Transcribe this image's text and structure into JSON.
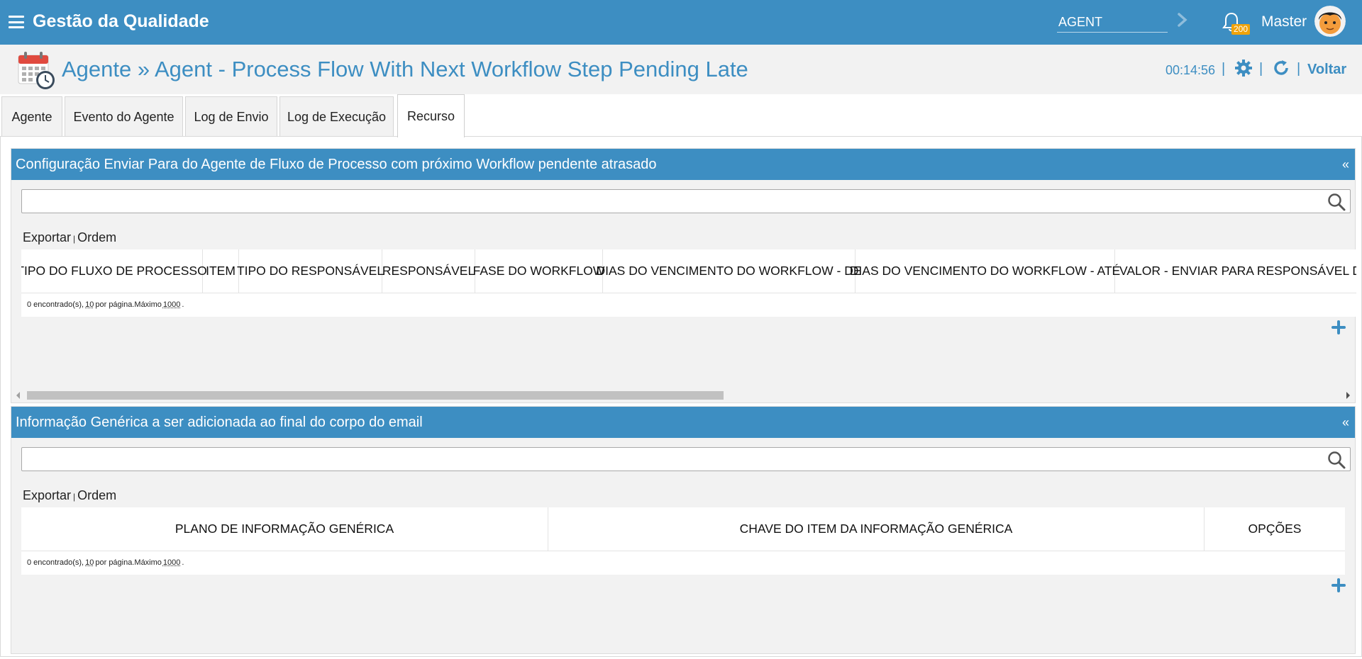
{
  "topbar": {
    "app_title": "Gestão da Qualidade",
    "search_value": "AGENT",
    "notifications_count": "200",
    "user_name": "Master"
  },
  "header": {
    "title": "Agente » Agent - Process Flow With Next Workflow Step Pending Late",
    "timer": "00:14:56",
    "back_label": "Voltar"
  },
  "tabs": [
    {
      "label": "Agente"
    },
    {
      "label": "Evento do Agente"
    },
    {
      "label": "Log de Envio"
    },
    {
      "label": "Log de Execução"
    },
    {
      "label": "Recurso",
      "active": true
    }
  ],
  "panel1": {
    "title": "Configuração Enviar Para do Agente de Fluxo de Processo com próximo Workflow pendente atrasado",
    "collapse": "«",
    "search_value": "",
    "export_label": "Exportar",
    "order_label": "Ordem",
    "columns": [
      "TIPO DO FLUXO DE PROCESSO",
      "ITEM",
      "TIPO DO RESPONSÁVEL",
      "RESPONSÁVEL",
      "FASE DO WORKFLOW",
      "DIAS DO VENCIMENTO DO WORKFLOW - DE",
      "DIAS DO VENCIMENTO DO WORKFLOW - ATÉ",
      "VALOR - ENVIAR PARA RESPONSÁVEL DO"
    ],
    "footer": {
      "found": "0 encontrado(s),",
      "per_page": "10",
      "per_page_label": "por página.Máximo",
      "max": "1000",
      "end": "."
    }
  },
  "panel2": {
    "title": "Informação Genérica a ser adicionada ao final do corpo do email",
    "collapse": "«",
    "search_value": "",
    "export_label": "Exportar",
    "order_label": "Ordem",
    "columns": [
      "PLANO DE INFORMAÇÃO GENÉRICA",
      "CHAVE DO ITEM DA INFORMAÇÃO GENÉRICA",
      "OPÇÕES"
    ],
    "footer": {
      "found": "0 encontrado(s),",
      "per_page": "10",
      "per_page_label": "por página.Máximo",
      "max": "1000",
      "end": "."
    }
  },
  "colors": {
    "accent": "#3d8ec2",
    "badge": "#f0a30a",
    "panel_bg": "#f2f2f2"
  }
}
